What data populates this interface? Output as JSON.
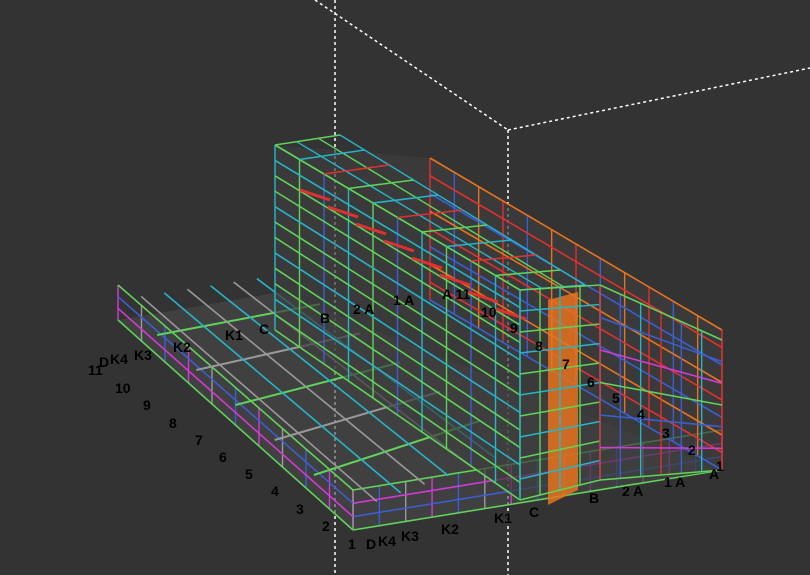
{
  "viewport": {
    "background": "#333333"
  },
  "colors": {
    "cyan": "#26b5c8",
    "green": "#5fd35a",
    "blue": "#3a5fd0",
    "magenta": "#d23ad6",
    "red": "#e03030",
    "orange": "#e8731f",
    "grey": "#9a9a9a",
    "yellow": "#e0c040"
  },
  "grid_labels": {
    "left_axis": [
      "11",
      "D",
      "K4",
      "K3",
      "K2",
      "K1",
      "C"
    ],
    "left_numbers": [
      "10",
      "9",
      "8",
      "7",
      "6",
      "5",
      "4",
      "3",
      "2",
      "1"
    ],
    "front_axis": [
      "D",
      "K4",
      "K3",
      "K2",
      "K1",
      "C",
      "B",
      "2 A",
      "1 A",
      "A",
      "1"
    ],
    "tower_top": [
      "B",
      "2 A",
      "1 A",
      "A 11",
      "10",
      "9",
      "8",
      "7",
      "6",
      "5",
      "4",
      "3",
      "2"
    ]
  }
}
